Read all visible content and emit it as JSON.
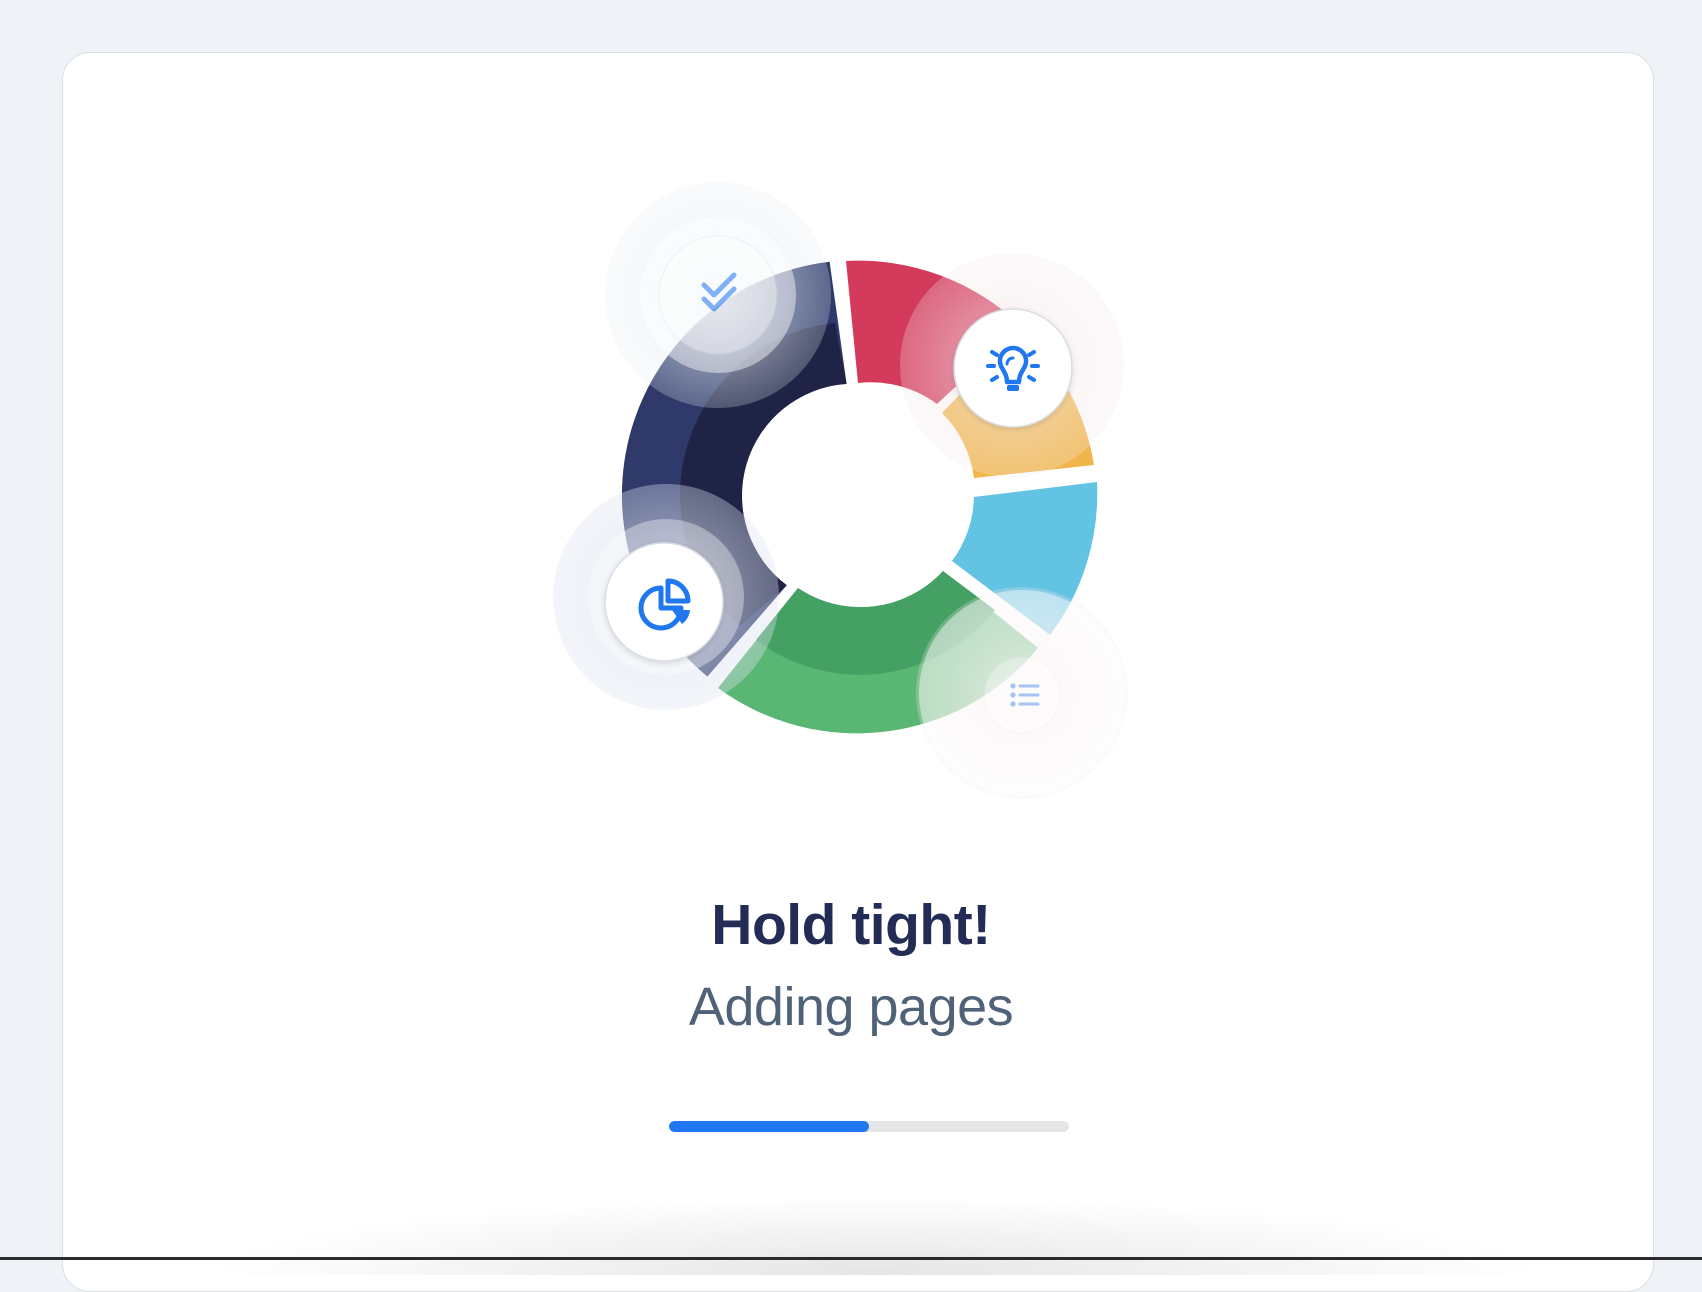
{
  "loader": {
    "title": "Hold tight!",
    "subtitle": "Adding pages",
    "progress": 0.5
  },
  "colors": {
    "navy": "#1f2447",
    "red": "#d33a5c",
    "orange": "#f0b64a",
    "cyan": "#4fb9dc",
    "green": "#4aa866",
    "accent": "#1f78f0",
    "title": "#232c54",
    "subtitle": "#4f6277"
  },
  "icons": [
    "double-check-icon",
    "lightbulb-icon",
    "pie-chart-icon",
    "list-icon"
  ]
}
